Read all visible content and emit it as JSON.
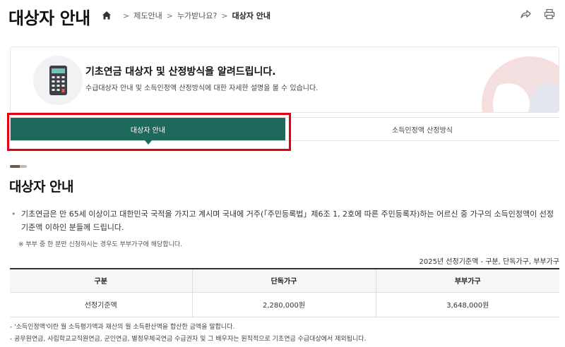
{
  "header": {
    "title": "대상자 안내",
    "breadcrumb": [
      "제도안내",
      "누가받나요?",
      "대상자 안내"
    ],
    "icons": [
      "home-icon",
      "share-icon",
      "print-icon"
    ]
  },
  "intro": {
    "heading": "기초연금 대상자 및 산정방식을 알려드립니다.",
    "description": "수급대상자 안내 및 소득인정액 산정방식에 대한 자세한 설명을 볼 수 있습니다.",
    "icon": "calculator-icon"
  },
  "tabs": [
    {
      "label": "대상자 안내",
      "active": true
    },
    {
      "label": "소득인정액 산정방식",
      "active": false
    }
  ],
  "section": {
    "title": "대상자 안내",
    "body": "기초연금은 만 65세 이상이고 대한민국 국적을 가지고 계시며 국내에 거주(「주민등록법」제6조 1, 2호에 따른 주민등록자)하는 어르신 중 가구의 소득인정액이 선정기준액 이하인 분들께 드립니다.",
    "note": "※ 부부 중 한 분만 신청하시는 경우도 부부가구에 해당합니다."
  },
  "table": {
    "caption": "2025년 선정기준액 - 구분, 단독가구, 부부가구",
    "headers": [
      "구분",
      "단독가구",
      "부부가구"
    ],
    "rows": [
      [
        "선정기준액",
        "2,280,000원",
        "3,648,000원"
      ]
    ]
  },
  "footnotes": [
    "- '소득인정액'이란 월 소득평가액과 재산의 월 소득환산액을 합산한 금액을 말합니다.",
    "- 공무원연금, 사립학교교직원연금, 군인연금, 별정우체국연금 수급권자 및 그 배우자는 원칙적으로 기초연금 수급대상에서 제외됩니다."
  ],
  "colors": {
    "accent": "#1d6a5c",
    "highlight": "#e60012"
  }
}
